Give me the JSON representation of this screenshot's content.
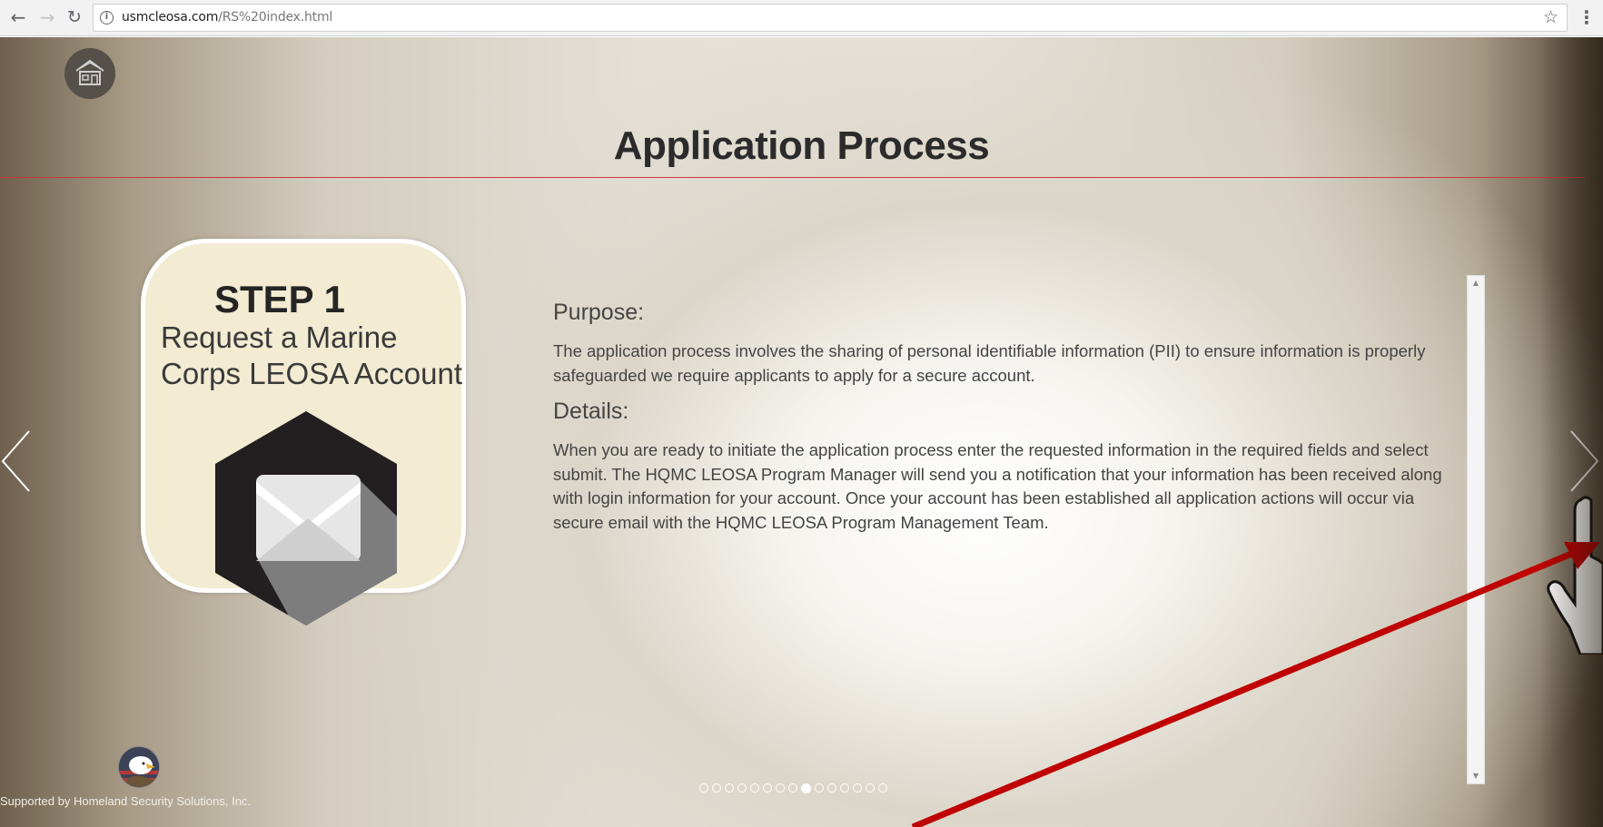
{
  "browser": {
    "back_icon": "arrow-left-icon",
    "forward_icon": "arrow-right-icon",
    "reload_icon": "reload-icon",
    "url_domain": "usmcleosa.com",
    "url_path": "/RS%20index.html",
    "info_icon": "info-icon",
    "bookmark_icon": "star-icon",
    "menu_icon": "kebab-menu-icon"
  },
  "page": {
    "home_icon": "home-icon",
    "title": "Application Process",
    "step": {
      "title": "STEP 1",
      "subtitle": "Request a Marine Corps LEOSA Account",
      "icon": "envelope-icon"
    },
    "purpose": {
      "heading": "Purpose:",
      "text": "The application process involves the sharing of personal identifiable information (PII) to ensure information is properly safeguarded we require applicants to apply for a secure account."
    },
    "details": {
      "heading": "Details:",
      "text": "When you are ready to initiate the application process enter the requested information in the required fields and select submit. The HQMC LEOSA Program Manager will send you a notification that your information has been received along with login information for your account. Once your account has been established all application actions will occur via secure email with the HQMC LEOSA Program Management Team."
    },
    "pagination": {
      "total": 15,
      "active_index": 8
    },
    "footer": {
      "supported_by": "Supported by Homeland Security Solutions, Inc."
    },
    "colors": {
      "rule": "#c43a3a",
      "card": "#f3ebd2",
      "annotation_arrow": "#c00000"
    }
  }
}
